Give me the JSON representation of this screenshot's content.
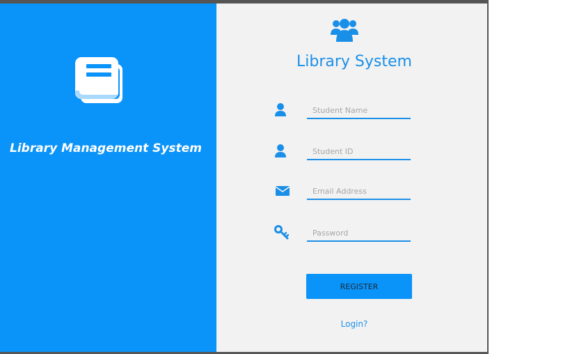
{
  "left_panel": {
    "app_title": "Library Management System",
    "logo_icon": "book-icon"
  },
  "form": {
    "header_icon": "users-icon",
    "title": "Library System",
    "fields": [
      {
        "icon": "user-icon",
        "placeholder": "Student Name",
        "value": ""
      },
      {
        "icon": "user-icon",
        "placeholder": "Student ID",
        "value": ""
      },
      {
        "icon": "envelope-icon",
        "placeholder": "Email Address",
        "value": ""
      },
      {
        "icon": "key-icon",
        "placeholder": "Password",
        "value": ""
      }
    ],
    "register_label": "REGISTER",
    "login_label": "Login?"
  },
  "colors": {
    "accent": "#0a93f8",
    "text_accent": "#1a8fe8",
    "panel_bg": "#f2f2f2",
    "frame": "#555555"
  }
}
